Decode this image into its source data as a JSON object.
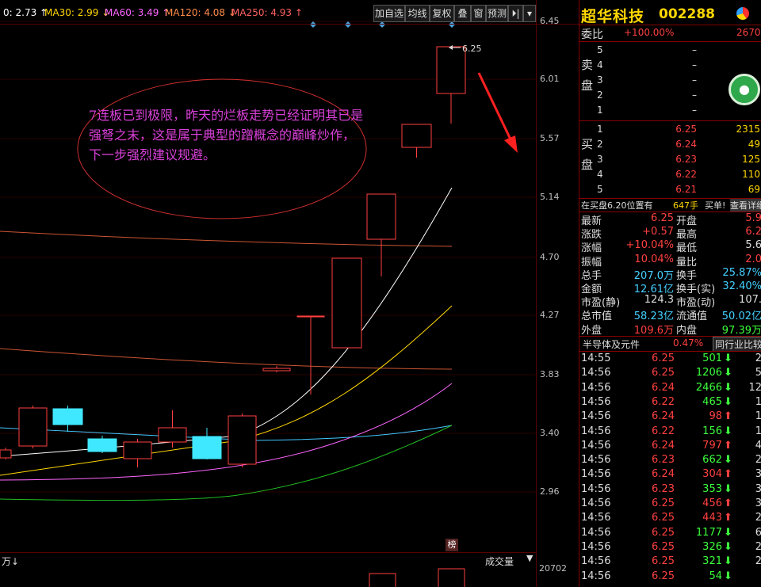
{
  "toolbar": {
    "ma_labels": [
      {
        "text": "0: 2.73 ↑",
        "color": "#ffffff"
      },
      {
        "text": "MA30: 2.99 ↓",
        "color": "#ffd700"
      },
      {
        "text": "MA60: 3.49 ↑",
        "color": "#ff66ff"
      },
      {
        "text": "MA120: 4.08 ↓",
        "color": "#ff8c4a"
      },
      {
        "text": "MA250: 4.93 ↑",
        "color": "#ff6060"
      }
    ],
    "buttons": [
      "加自选",
      "均线",
      "复权",
      "叠",
      "窗",
      "预测",
      "⏵|",
      "▾"
    ]
  },
  "price_axis": [
    "6.45",
    "6.01",
    "5.57",
    "5.14",
    "4.70",
    "4.27",
    "3.83",
    "3.40",
    "2.96"
  ],
  "volume_axis": "20702",
  "peak_label": "6.25",
  "annotation": "7连板已到极限，昨天的烂板走势已经证明其已是强弩之末，这是属于典型的蹭概念的巅峰炒作，下一步强烈建议规避。",
  "bang_label": "榜",
  "volume_left_label": "万↓",
  "volume_select": "成交量",
  "colors": {
    "up": "#ff4040",
    "down": "#40e8ff",
    "ma_white": "#ffffff",
    "ma_yellow": "#ffd700",
    "ma_pink": "#ff66ff",
    "ma_cyan": "#44c8ff",
    "ma_green": "#22bb22",
    "ma_brown": "#cc5533"
  },
  "stock": {
    "name": "超华科技",
    "code": "002288"
  },
  "weibi": {
    "label": "委比",
    "value": "+100.00%",
    "extra": "2670"
  },
  "sell_label": "卖盘",
  "buy_label": "买盘",
  "sell_orders": [
    {
      "level": "5",
      "price": "–",
      "vol": ""
    },
    {
      "level": "4",
      "price": "–",
      "vol": ""
    },
    {
      "level": "3",
      "price": "–",
      "vol": ""
    },
    {
      "level": "2",
      "price": "–",
      "vol": ""
    },
    {
      "level": "1",
      "price": "–",
      "vol": ""
    }
  ],
  "buy_orders": [
    {
      "level": "1",
      "price": "6.25",
      "vol": "2315"
    },
    {
      "level": "2",
      "price": "6.24",
      "vol": "49"
    },
    {
      "level": "3",
      "price": "6.23",
      "vol": "125"
    },
    {
      "level": "4",
      "price": "6.22",
      "vol": "110"
    },
    {
      "level": "5",
      "price": "6.21",
      "vol": "69"
    }
  ],
  "tip": {
    "text": "在买盘6.20位置有",
    "vol": "647手",
    "tag": "买单!",
    "link": "查看详细"
  },
  "quote": [
    {
      "l1": "最新",
      "v1": "6.25",
      "c1": "red",
      "l2": "开盘",
      "v2": "5.9",
      "c2": "red"
    },
    {
      "l1": "涨跌",
      "v1": "+0.57",
      "c1": "red",
      "l2": "最高",
      "v2": "6.2",
      "c2": "red"
    },
    {
      "l1": "涨幅",
      "v1": "+10.04%",
      "c1": "red",
      "l2": "最低",
      "v2": "5.6",
      "c2": "white"
    },
    {
      "l1": "振幅",
      "v1": "10.04%",
      "c1": "red",
      "l2": "量比",
      "v2": "2.0",
      "c2": "red"
    },
    {
      "l1": "总手",
      "v1": "207.0万",
      "c1": "cyan",
      "l2": "换手",
      "v2": "25.87%",
      "c2": "cyan"
    },
    {
      "l1": "金额",
      "v1": "12.61亿",
      "c1": "cyan",
      "l2": "换手(实)",
      "v2": "32.40%",
      "c2": "cyan"
    },
    {
      "l1": "市盈(静)",
      "v1": "124.3",
      "c1": "white",
      "l2": "市盈(动)",
      "v2": "107.",
      "c2": "white"
    },
    {
      "l1": "总市值",
      "v1": "58.23亿",
      "c1": "cyan",
      "l2": "流通值",
      "v2": "50.02亿",
      "c2": "cyan"
    },
    {
      "l1": "外盘",
      "v1": "109.6万",
      "c1": "red",
      "l2": "内盘",
      "v2": "97.39万",
      "c2": "green"
    }
  ],
  "sector": {
    "name": "半导体及元件",
    "change": "0.47%",
    "button": "同行业比较"
  },
  "ticks": [
    {
      "time": "14:55",
      "price": "6.25",
      "vol": "501",
      "dir": "down",
      "n": "2"
    },
    {
      "time": "14:56",
      "price": "6.25",
      "vol": "1206",
      "dir": "down",
      "n": "5"
    },
    {
      "time": "14:56",
      "price": "6.24",
      "vol": "2466",
      "dir": "down",
      "n": "12"
    },
    {
      "time": "14:56",
      "price": "6.22",
      "vol": "465",
      "dir": "down",
      "n": "1"
    },
    {
      "time": "14:56",
      "price": "6.24",
      "vol": "98",
      "dir": "up",
      "n": "1"
    },
    {
      "time": "14:56",
      "price": "6.22",
      "vol": "156",
      "dir": "down",
      "n": "1"
    },
    {
      "time": "14:56",
      "price": "6.24",
      "vol": "797",
      "dir": "up",
      "n": "4"
    },
    {
      "time": "14:56",
      "price": "6.23",
      "vol": "662",
      "dir": "down",
      "n": "2"
    },
    {
      "time": "14:56",
      "price": "6.24",
      "vol": "304",
      "dir": "up",
      "n": "3"
    },
    {
      "time": "14:56",
      "price": "6.23",
      "vol": "353",
      "dir": "down",
      "n": "3"
    },
    {
      "time": "14:56",
      "price": "6.25",
      "vol": "456",
      "dir": "up",
      "n": "3"
    },
    {
      "time": "14:56",
      "price": "6.25",
      "vol": "443",
      "dir": "up",
      "n": "2"
    },
    {
      "time": "14:56",
      "price": "6.25",
      "vol": "1177",
      "dir": "down",
      "n": "6"
    },
    {
      "time": "14:56",
      "price": "6.25",
      "vol": "326",
      "dir": "down",
      "n": "2"
    },
    {
      "time": "14:56",
      "price": "6.25",
      "vol": "321",
      "dir": "down",
      "n": "2"
    },
    {
      "time": "14:56",
      "price": "6.25",
      "vol": "54",
      "dir": "down",
      "n": ""
    }
  ]
}
